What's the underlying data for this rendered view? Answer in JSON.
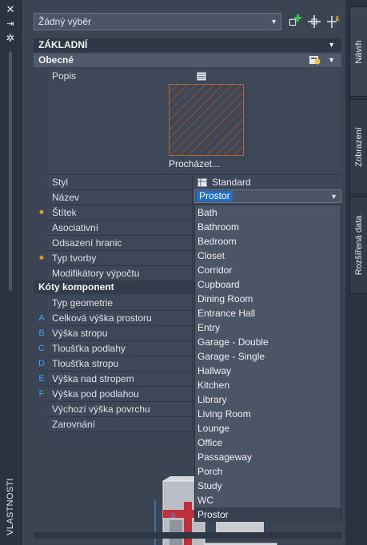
{
  "palette": {
    "title": "VLASTNOSTI",
    "close_glyph": "✕",
    "autohide_glyph": "⇥",
    "settings_glyph": "✲"
  },
  "toolbar": {
    "selection_value": "Žádný výběr",
    "icons": [
      "add-selected-icon",
      "quick-select-icon",
      "select-objects-icon"
    ]
  },
  "sections": {
    "basic": {
      "title": "ZÁKLADNÍ"
    },
    "general": {
      "title": "Obecné"
    },
    "component_dims": {
      "title": "Kóty komponent"
    }
  },
  "general_rows": {
    "description": {
      "label": "Popis"
    },
    "browse_label": "Procházet...",
    "style": {
      "label": "Styl",
      "value": "Standard"
    },
    "name": {
      "label": "Název",
      "value": "Prostor"
    },
    "tag": {
      "label": "Štítek"
    },
    "associative": {
      "label": "Asociativní"
    },
    "boundary_offset": {
      "label": "Odsazení hranic"
    },
    "creation_type": {
      "label": "Typ tvorby"
    },
    "calc_modifiers": {
      "label": "Modifikátory výpočtu"
    }
  },
  "dims_rows": [
    {
      "marker": "",
      "label": "Typ geometrie"
    },
    {
      "marker": "A",
      "label": "Celková výška prostoru"
    },
    {
      "marker": "B",
      "label": "Výška stropu"
    },
    {
      "marker": "C",
      "label": "Tloušťka podlahy"
    },
    {
      "marker": "D",
      "label": "Tloušťka stropu"
    },
    {
      "marker": "E",
      "label": "Výška nad stropem"
    },
    {
      "marker": "F",
      "label": "Výška pod podlahou"
    },
    {
      "marker": "",
      "label": "Výchozí výška povrchu"
    },
    {
      "marker": "",
      "label": "Zarovnání"
    }
  ],
  "name_options": [
    "Bath",
    "Bathroom",
    "Bedroom",
    "Closet",
    "Corridor",
    "Cupboard",
    "Dining Room",
    "Entrance Hall",
    "Entry",
    "Garage - Double",
    "Garage - Single",
    "Hallway",
    "Kitchen",
    "Library",
    "Living Room",
    "Lounge",
    "Office",
    "Passageway",
    "Porch",
    "Study",
    "WC",
    "Prostor"
  ],
  "right_tabs": {
    "design": "Návrh",
    "display": "Zobrazení",
    "extended_data": "Rozšířená data"
  },
  "colors": {
    "background": "#3b4453",
    "selection": "#1f6fd0",
    "required_marker": "#f7a824",
    "dim_marker": "#3ea0ff"
  }
}
